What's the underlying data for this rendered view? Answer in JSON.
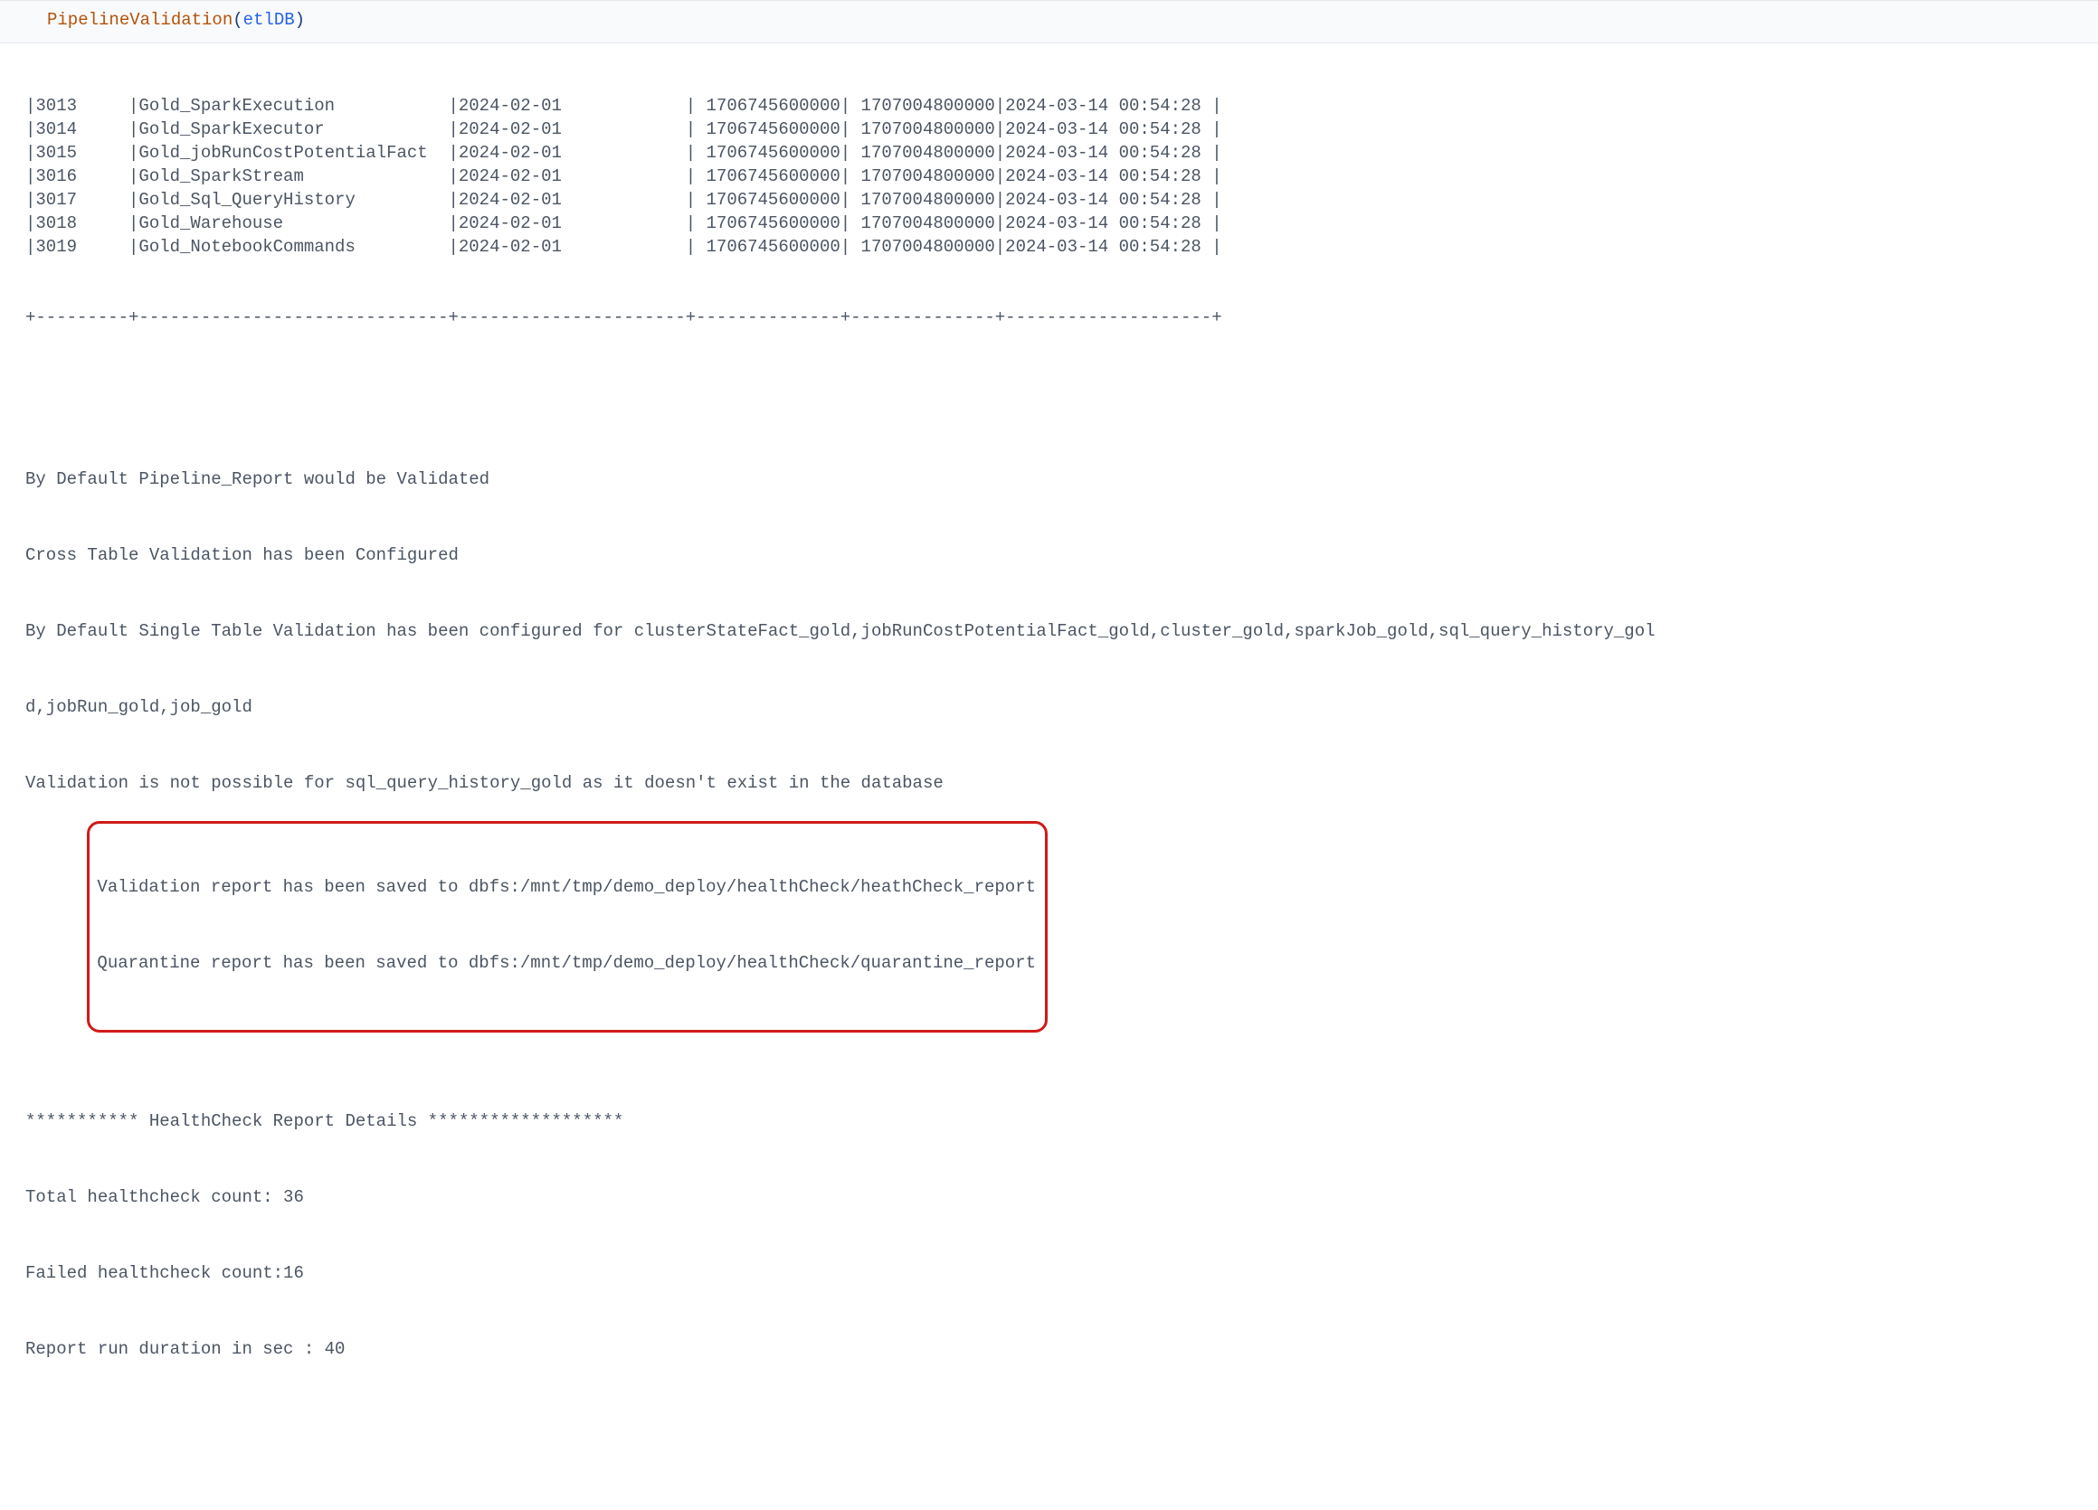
{
  "code": {
    "fn": "PipelineValidation",
    "arg": "etlDB"
  },
  "table": {
    "colWidths": {
      "id": 9,
      "name": 30,
      "date": 22,
      "ts1": 14,
      "ts2": 14,
      "updated": 20
    },
    "rows": [
      {
        "id": "3013",
        "name": "Gold_SparkExecution",
        "date": "2024-02-01",
        "ts1": "1706745600000",
        "ts2": "1707004800000",
        "updated": "2024-03-14 00:54:28"
      },
      {
        "id": "3014",
        "name": "Gold_SparkExecutor",
        "date": "2024-02-01",
        "ts1": "1706745600000",
        "ts2": "1707004800000",
        "updated": "2024-03-14 00:54:28"
      },
      {
        "id": "3015",
        "name": "Gold_jobRunCostPotentialFact",
        "date": "2024-02-01",
        "ts1": "1706745600000",
        "ts2": "1707004800000",
        "updated": "2024-03-14 00:54:28"
      },
      {
        "id": "3016",
        "name": "Gold_SparkStream",
        "date": "2024-02-01",
        "ts1": "1706745600000",
        "ts2": "1707004800000",
        "updated": "2024-03-14 00:54:28"
      },
      {
        "id": "3017",
        "name": "Gold_Sql_QueryHistory",
        "date": "2024-02-01",
        "ts1": "1706745600000",
        "ts2": "1707004800000",
        "updated": "2024-03-14 00:54:28"
      },
      {
        "id": "3018",
        "name": "Gold_Warehouse",
        "date": "2024-02-01",
        "ts1": "1706745600000",
        "ts2": "1707004800000",
        "updated": "2024-03-14 00:54:28"
      },
      {
        "id": "3019",
        "name": "Gold_NotebookCommands",
        "date": "2024-02-01",
        "ts1": "1706745600000",
        "ts2": "1707004800000",
        "updated": "2024-03-14 00:54:28"
      }
    ]
  },
  "messages": {
    "m1": "By Default Pipeline_Report would be Validated",
    "m2": "Cross Table Validation has been Configured",
    "m3": "By Default Single Table Validation has been configured for clusterStateFact_gold,jobRunCostPotentialFact_gold,cluster_gold,sparkJob_gold,sql_query_history_gol",
    "m3b": "d,jobRun_gold,job_gold",
    "m4": "Validation is not possible for sql_query_history_gold as it doesn't exist in the database",
    "h1": "Validation report has been saved to dbfs:/mnt/tmp/demo_deploy/healthCheck/heathCheck_report",
    "h2": "Quarantine report has been saved to dbfs:/mnt/tmp/demo_deploy/healthCheck/quarantine_report",
    "s1": "*********** HealthCheck Report Details *******************",
    "s2": "Total healthcheck count: 36",
    "s3": "Failed healthcheck count:16",
    "s4": "Report run duration in sec : 40"
  }
}
